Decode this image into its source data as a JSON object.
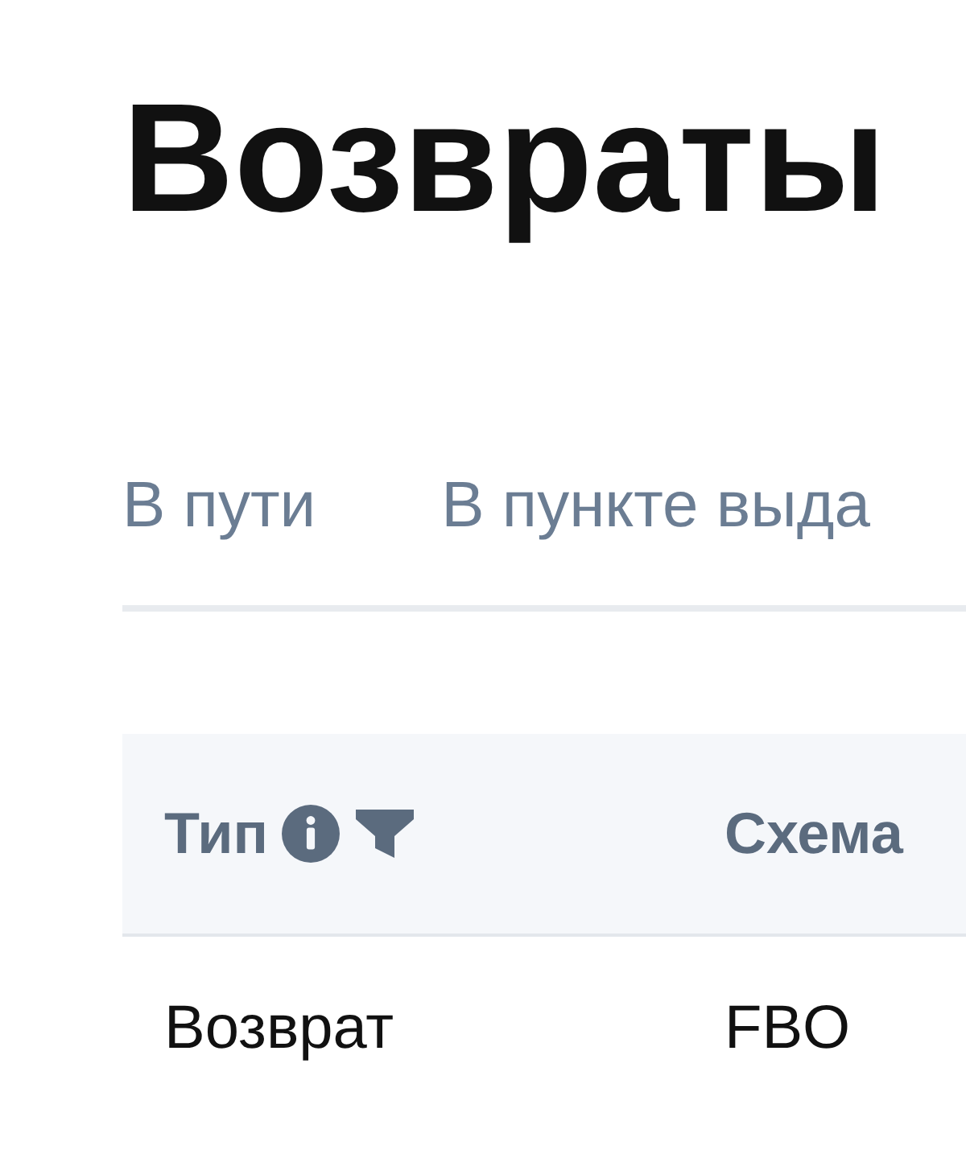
{
  "title": "Возвраты",
  "tabs": [
    {
      "label": "В пути"
    },
    {
      "label": "В пункте выда"
    }
  ],
  "table": {
    "columns": [
      {
        "label": "Тип",
        "info": true,
        "filter": true
      },
      {
        "label": "Схема",
        "info": false,
        "filter": false
      }
    ],
    "rows": [
      [
        "Возврат",
        "FBO"
      ]
    ]
  }
}
